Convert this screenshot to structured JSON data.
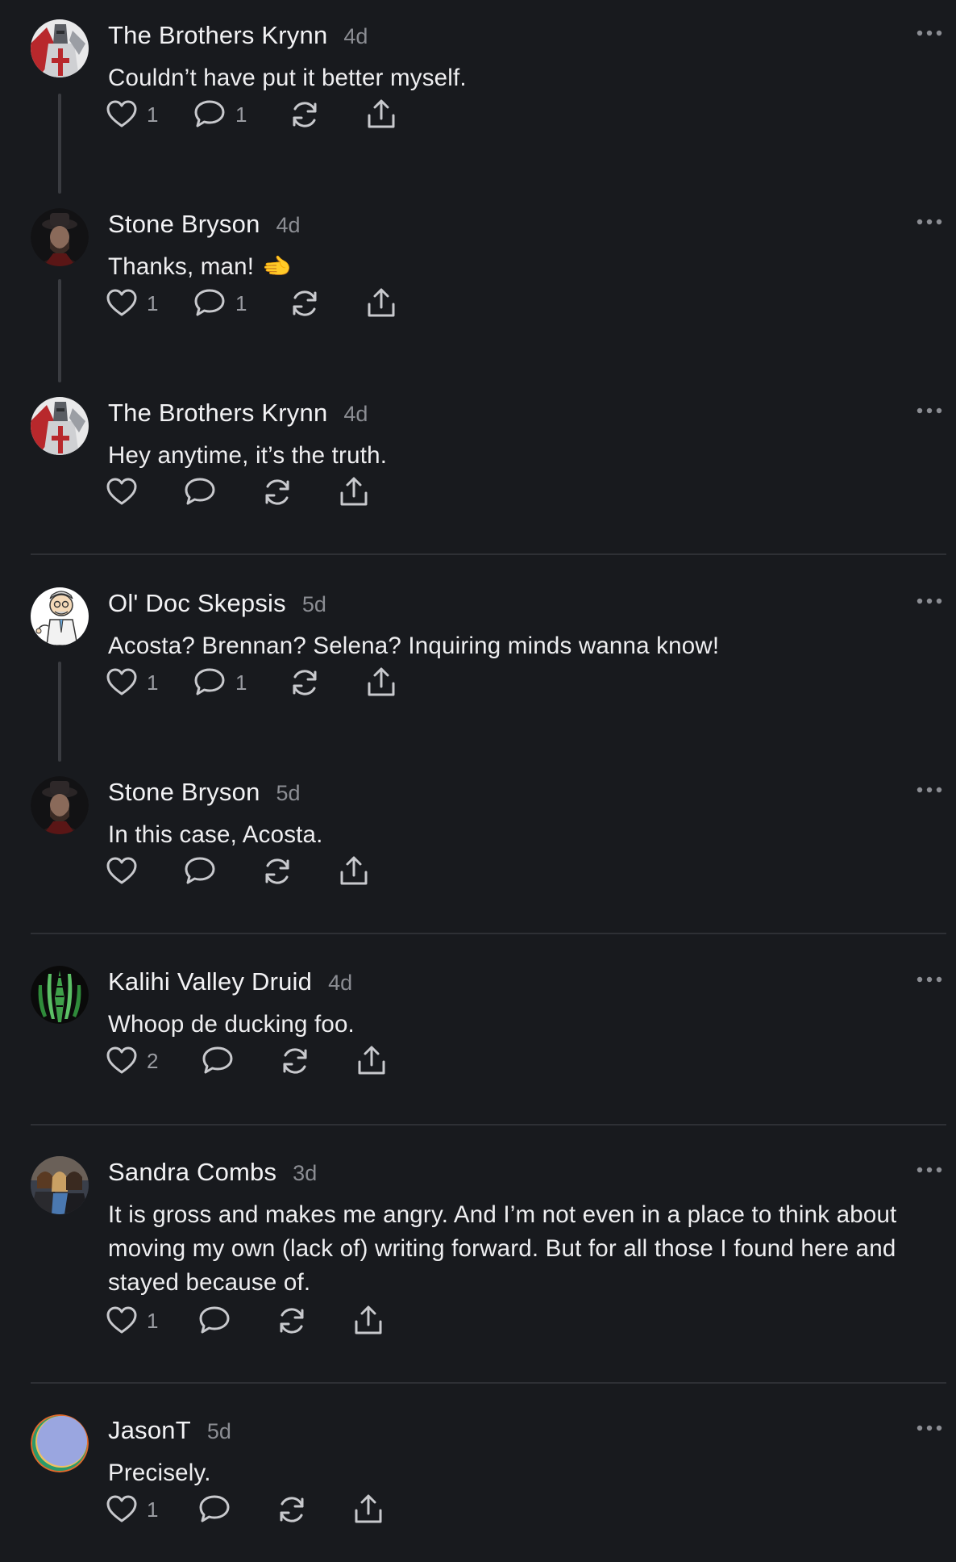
{
  "colors": {
    "background": "#181a1e",
    "text": "#eeeef0",
    "muted": "#8b8d93",
    "icon": "#c8c9cd",
    "separator": "#2e3035",
    "thread_line": "#3a3c41"
  },
  "comments": [
    {
      "author": "The Brothers Krynn",
      "age": "4d",
      "text": "Couldn’t have put it better myself.",
      "likes": "1",
      "replies": "1",
      "avatar_icon": "knight-avatar"
    },
    {
      "author": "Stone Bryson",
      "age": "4d",
      "text": "Thanks, man!",
      "emoji": "🫲",
      "likes": "1",
      "replies": "1",
      "avatar_icon": "hat-man-avatar"
    },
    {
      "author": "The Brothers Krynn",
      "age": "4d",
      "text": "Hey anytime, it’s the truth.",
      "likes": "",
      "replies": "",
      "avatar_icon": "knight-avatar"
    },
    {
      "author": "Ol' Doc Skepsis",
      "age": "5d",
      "text": "Acosta? Brennan? Selena? Inquiring minds wanna know!",
      "likes": "1",
      "replies": "1",
      "avatar_icon": "doctor-cartoon-avatar"
    },
    {
      "author": "Stone Bryson",
      "age": "5d",
      "text": "In this case, Acosta.",
      "likes": "",
      "replies": "",
      "avatar_icon": "hat-man-avatar"
    },
    {
      "author": "Kalihi Valley Druid",
      "age": "4d",
      "text": "Whoop de ducking foo.",
      "likes": "2",
      "replies": "",
      "avatar_icon": "green-leaf-avatar"
    },
    {
      "author": "Sandra Combs",
      "age": "3d",
      "text": "It is gross and makes me angry. And I’m not even in a place to think about moving my own (lack of) writing forward. But for all those I found here and stayed because of.",
      "likes": "1",
      "replies": "",
      "avatar_icon": "group-photo-avatar"
    },
    {
      "author": "JasonT",
      "age": "5d",
      "text": "Precisely.",
      "likes": "1",
      "replies": "",
      "avatar_icon": "gradient-circle-avatar"
    }
  ]
}
